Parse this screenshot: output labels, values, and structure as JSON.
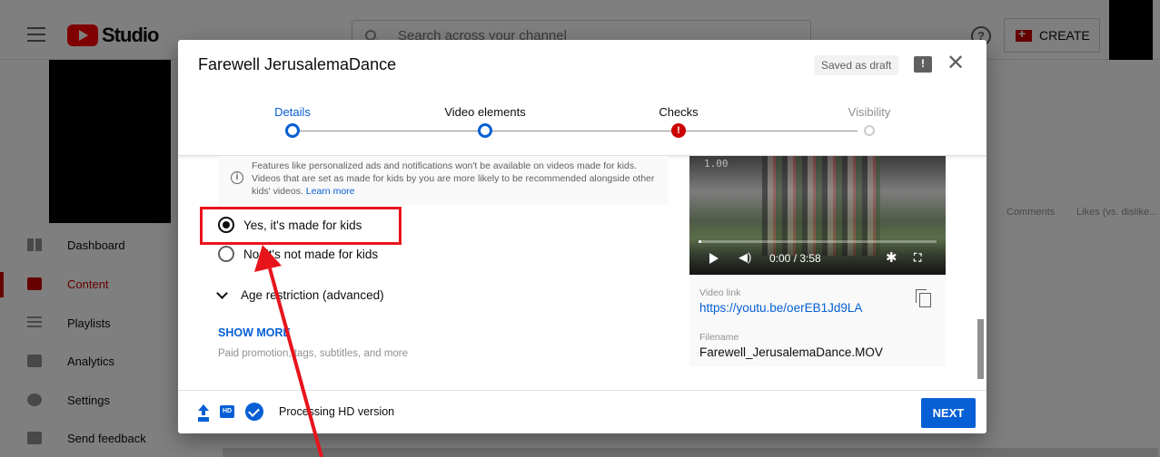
{
  "app": {
    "logo_text": "Studio",
    "search_placeholder": "Search across your channel",
    "help_glyph": "?",
    "create_label": "CREATE"
  },
  "sidebar": {
    "items": [
      {
        "label": "Dashboard",
        "icon": "dashboard-icon",
        "active": false
      },
      {
        "label": "Content",
        "icon": "content-icon",
        "active": true
      },
      {
        "label": "Playlists",
        "icon": "playlists-icon",
        "active": false
      },
      {
        "label": "Analytics",
        "icon": "analytics-icon",
        "active": false
      },
      {
        "label": "Settings",
        "icon": "gear-icon",
        "active": false
      },
      {
        "label": "Send feedback",
        "icon": "feedback-icon",
        "active": false
      }
    ]
  },
  "table": {
    "columns": [
      "Comments",
      "Likes (vs. dislike..."
    ]
  },
  "modal": {
    "title": "Farewell JerusalemaDance",
    "saved_status": "Saved as draft",
    "alert_glyph": "!",
    "close_glyph": "✕",
    "steps": [
      {
        "label": "Details",
        "state": "done",
        "color": "#065fd4"
      },
      {
        "label": "Video elements",
        "state": "done",
        "color": "#0d0d0d"
      },
      {
        "label": "Checks",
        "state": "error",
        "color": "#0d0d0d"
      },
      {
        "label": "Visibility",
        "state": "todo",
        "color": "#909090"
      }
    ],
    "info": {
      "text": "Features like personalized ads and notifications won't be available on videos made for kids. Videos that are set as made for kids by you are more likely to be recommended alongside other kids' videos.",
      "link": "Learn more"
    },
    "audience": {
      "options": [
        {
          "label": "Yes, it's made for kids",
          "selected": true
        },
        {
          "label": "No, it's not made for kids",
          "selected": false
        }
      ]
    },
    "age_restriction_label": "Age restriction (advanced)",
    "show_more_label": "SHOW MORE",
    "show_more_hint": "Paid promotion, tags, subtitles, and more",
    "video": {
      "timestamp_overlay": "1.00",
      "time": "0:00 / 3:58",
      "progress": 0.0,
      "link_label": "Video link",
      "link": "https://youtu.be/oerEB1Jd9LA",
      "filename_label": "Filename",
      "filename": "Farewell_JerusalemaDance.MOV"
    },
    "footer": {
      "hd_badge": "HD",
      "status": "Processing HD version",
      "next_label": "NEXT"
    }
  },
  "annotation": {
    "highlight_color": "#e8141c"
  }
}
